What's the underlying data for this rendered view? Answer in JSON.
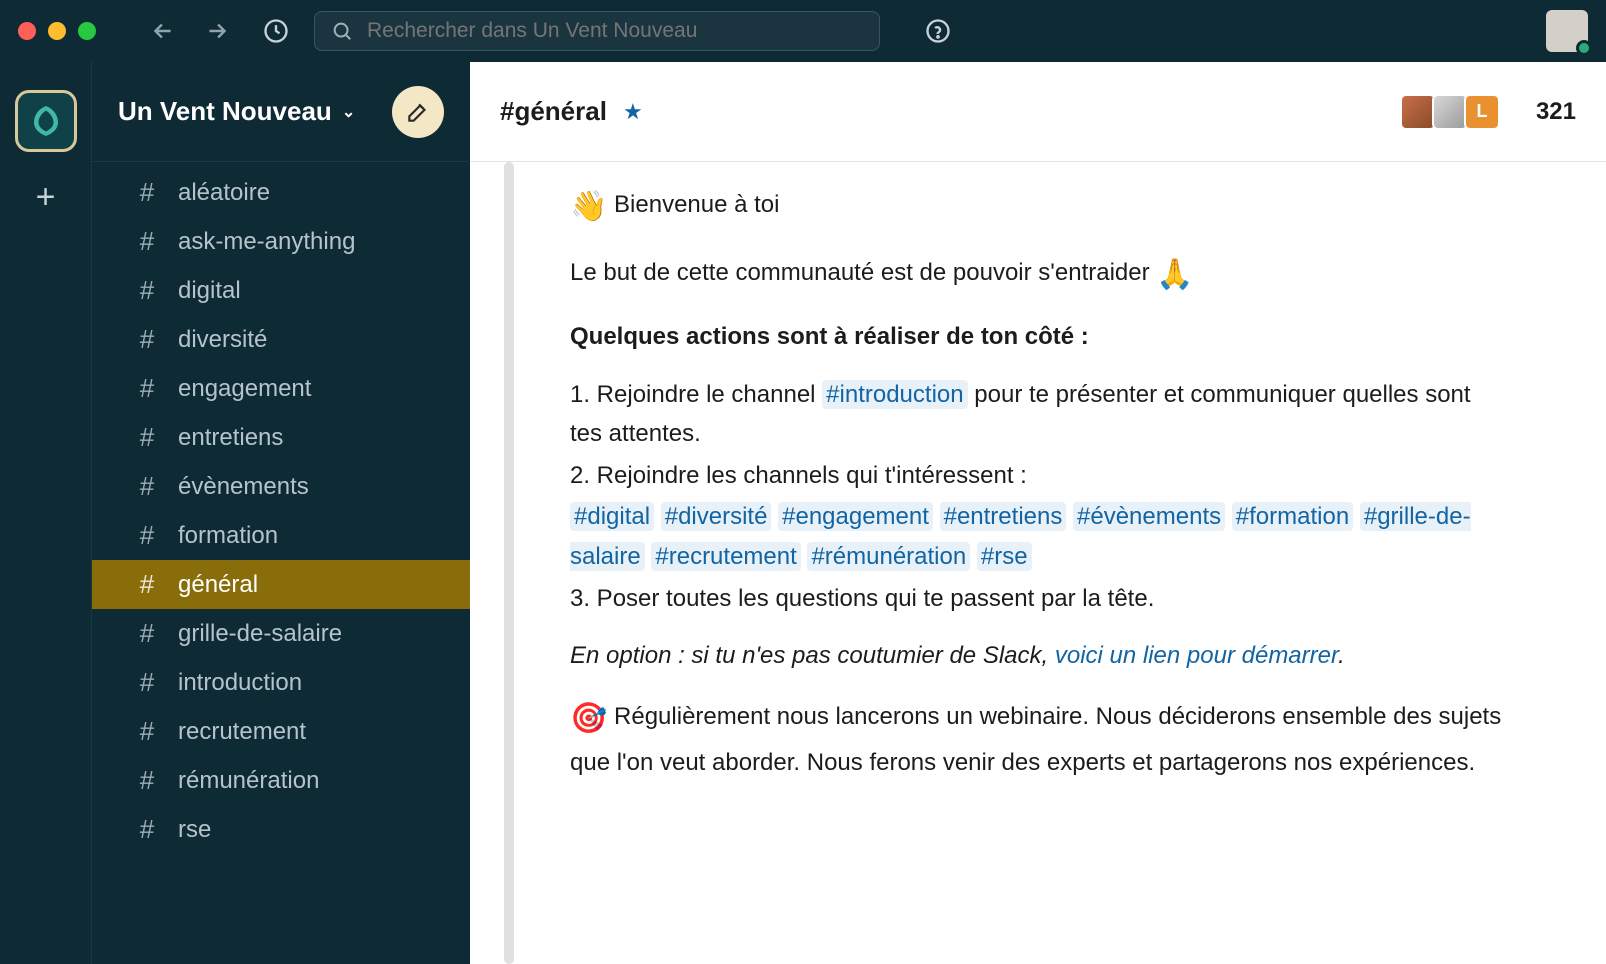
{
  "search": {
    "placeholder": "Rechercher dans Un Vent Nouveau"
  },
  "workspace": {
    "name": "Un Vent Nouveau"
  },
  "sidebar": {
    "channels": [
      {
        "name": "aléatoire",
        "active": false
      },
      {
        "name": "ask-me-anything",
        "active": false
      },
      {
        "name": "digital",
        "active": false
      },
      {
        "name": "diversité",
        "active": false
      },
      {
        "name": "engagement",
        "active": false
      },
      {
        "name": "entretiens",
        "active": false
      },
      {
        "name": "évènements",
        "active": false
      },
      {
        "name": "formation",
        "active": false
      },
      {
        "name": "général",
        "active": true
      },
      {
        "name": "grille-de-salaire",
        "active": false
      },
      {
        "name": "introduction",
        "active": false
      },
      {
        "name": "recrutement",
        "active": false
      },
      {
        "name": "rémunération",
        "active": false
      },
      {
        "name": "rse",
        "active": false
      }
    ]
  },
  "channel": {
    "title": "#général",
    "member_badge": "L",
    "member_count": "321"
  },
  "message": {
    "welcome_emoji": "👋",
    "welcome_text": "Bienvenue à toi",
    "purpose": "Le but de cette communauté est de pouvoir s'entraider",
    "purpose_emoji": "🙏",
    "actions_heading": "Quelques actions sont à réaliser de ton côté :",
    "step1_pre": "1. Rejoindre le channel ",
    "step1_link": "#introduction",
    "step1_post": " pour te présenter et communiquer quelles sont tes attentes.",
    "step2_pre": "2. Rejoindre les channels qui t'intéressent :",
    "step2_links": [
      "#digital",
      "#diversité",
      "#engagement",
      "#entretiens",
      "#évènements",
      "#formation",
      "#grille-de-salaire",
      "#recrutement",
      "#rémunération",
      "#rse"
    ],
    "step3": "3. Poser toutes les questions qui te passent par la tête.",
    "option_pre": "En option : si tu n'es pas coutumier de Slack, ",
    "option_link": "voici un lien pour démarrer",
    "option_post": ".",
    "webinar_emoji": "🎯",
    "webinar": "Régulièrement nous lancerons un webinaire. Nous déciderons ensemble des sujets que l'on veut aborder. Nous ferons venir des experts et partagerons nos expériences."
  }
}
